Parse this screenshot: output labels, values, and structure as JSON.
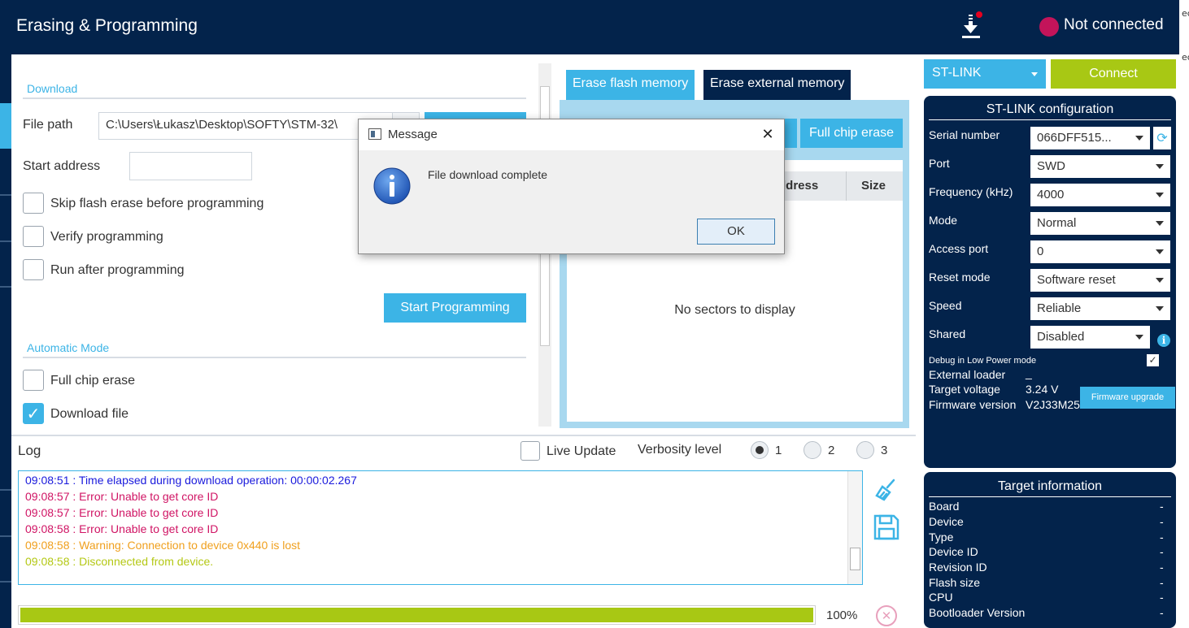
{
  "header": {
    "title": "Erasing & Programming",
    "status": "Not connected",
    "colors": {
      "bg": "#03234b",
      "status_dot": "#c3145a"
    }
  },
  "edge": {
    "t1": "ec",
    "t2": "ec"
  },
  "download": {
    "section": "Download",
    "file_path_label": "File path",
    "file_path_value": "C:\\Users\\Łukasz\\Desktop\\SOFTY\\STM-32\\",
    "start_address_label": "Start address",
    "start_address_value": "",
    "skip_erase_label": "Skip flash erase before programming",
    "verify_label": "Verify programming",
    "run_after_label": "Run after programming",
    "start_button": "Start Programming"
  },
  "automatic": {
    "section": "Automatic Mode",
    "full_chip_label": "Full chip erase",
    "download_file_label": "Download file"
  },
  "erase": {
    "tabs": [
      {
        "label": "Erase flash memory"
      },
      {
        "label": "Erase external memory"
      }
    ],
    "partial_button": "s",
    "full_chip_button": "Full chip erase",
    "col_address": "ddress",
    "col_size": "Size",
    "empty_text": "No sectors to display"
  },
  "dialog": {
    "title": "Message",
    "message": "File download complete",
    "ok": "OK",
    "close": "✕"
  },
  "right": {
    "probe_select": "ST-LINK",
    "connect": "Connect",
    "config_title": "ST-LINK configuration",
    "fields": [
      {
        "label": "Serial number",
        "value": "066DFF515..."
      },
      {
        "label": "Port",
        "value": "SWD"
      },
      {
        "label": "Frequency (kHz)",
        "value": "4000"
      },
      {
        "label": "Mode",
        "value": "Normal"
      },
      {
        "label": "Access port",
        "value": "0"
      },
      {
        "label": "Reset mode",
        "value": "Software reset"
      },
      {
        "label": "Speed",
        "value": "Reliable"
      },
      {
        "label": "Shared",
        "value": "Disabled"
      }
    ],
    "debug_low_power": "Debug in Low Power mode",
    "external_loader_label": "External loader",
    "external_loader_value": "_",
    "target_voltage_label": "Target voltage",
    "target_voltage_value": "3.24 V",
    "firmware_label": "Firmware version",
    "firmware_value": "V2J33M25",
    "firmware_upgrade": "Firmware upgrade",
    "target_title": "Target information",
    "target_rows": [
      {
        "label": "Board",
        "value": "-"
      },
      {
        "label": "Device",
        "value": "-"
      },
      {
        "label": "Type",
        "value": "-"
      },
      {
        "label": "Device ID",
        "value": "-"
      },
      {
        "label": "Revision ID",
        "value": "-"
      },
      {
        "label": "Flash size",
        "value": "-"
      },
      {
        "label": "CPU",
        "value": "-"
      },
      {
        "label": "Bootloader Version",
        "value": "-"
      }
    ],
    "colors": {
      "accent": "#3cb4e6",
      "connect": "#a8c814"
    }
  },
  "log": {
    "title": "Log",
    "live_update": "Live Update",
    "verbosity_label": "Verbosity level",
    "levels": [
      "1",
      "2",
      "3"
    ],
    "lines": [
      {
        "text": "09:08:51 : Time elapsed during download operation: 00:00:02.267",
        "color": "#1a1adc"
      },
      {
        "text": "09:08:57 : Error: Unable to get core ID",
        "color": "#d01464"
      },
      {
        "text": "09:08:57 : Error: Unable to get core ID",
        "color": "#d01464"
      },
      {
        "text": "09:08:58 : Error: Unable to get core ID",
        "color": "#d01464"
      },
      {
        "text": "09:08:58 : Warning: Connection to device 0x440 is lost",
        "color": "#f0a01e"
      },
      {
        "text": "09:08:58 : Disconnected from device.",
        "color": "#b4c814"
      }
    ],
    "progress_value": 1.0,
    "progress_text": "100%"
  }
}
